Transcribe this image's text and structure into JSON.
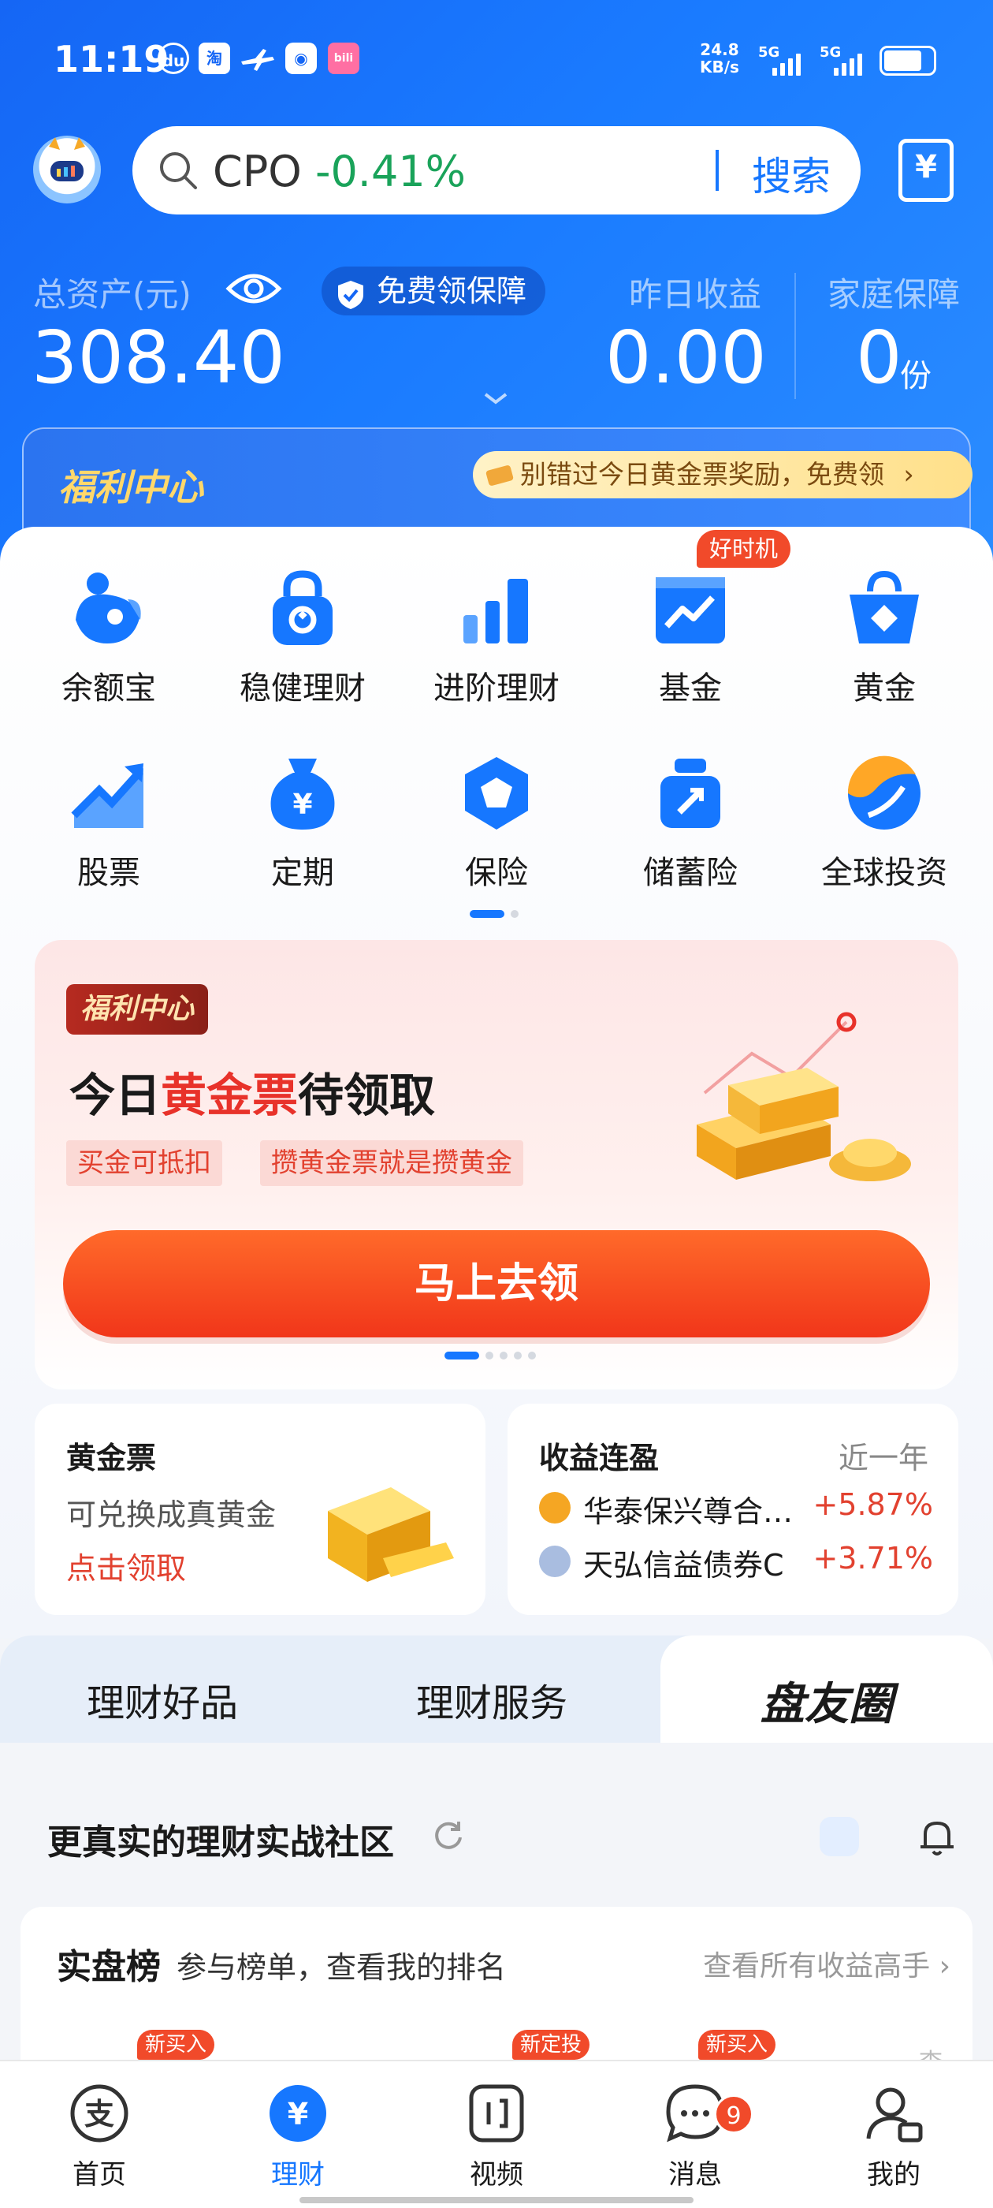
{
  "status_bar": {
    "time": "11:19",
    "net_speed_value": "24.8",
    "net_speed_unit": "KB/s",
    "sim1": "5G",
    "sim2": "5G",
    "icons": [
      "du-app-icon",
      "taobao-icon",
      "plane-icon",
      "camera-app-icon",
      "bilibili-icon"
    ]
  },
  "search": {
    "keyword": "CPO",
    "change": "-0.41%",
    "button": "搜索"
  },
  "assets": {
    "total_label": "总资产(元)",
    "total_value": "308.40",
    "guard_label": "免费领保障",
    "yesterday_label": "昨日收益",
    "yesterday_value": "0.00",
    "family_label": "家庭保障",
    "family_value": "0",
    "family_unit": "份"
  },
  "welfare_bar": {
    "title": "福利中心",
    "pill": "别错过今日黄金票奖励，免费领",
    "chevron": "›"
  },
  "grid": [
    {
      "label": "余额宝",
      "icon": "yuebao-icon"
    },
    {
      "label": "稳健理财",
      "icon": "wealth-lock-icon"
    },
    {
      "label": "进阶理财",
      "icon": "bar-growth-icon"
    },
    {
      "label": "基金",
      "icon": "fund-chart-icon"
    },
    {
      "label": "黄金",
      "icon": "gold-bag-icon"
    },
    {
      "label": "股票",
      "icon": "stock-trend-icon"
    },
    {
      "label": "定期",
      "icon": "money-bag-icon"
    },
    {
      "label": "保险",
      "icon": "insurance-hex-icon"
    },
    {
      "label": "储蓄险",
      "icon": "savings-jar-icon"
    },
    {
      "label": "全球投资",
      "icon": "globe-icon"
    }
  ],
  "grid_tag": "好时机",
  "banner": {
    "tag": "福利中心",
    "title_pre": "今日",
    "title_red": "黄金票",
    "title_post": "待领取",
    "chip1": "买金可抵扣",
    "chip2": "攒黄金票就是攒黄金",
    "button": "马上去领"
  },
  "gold_card": {
    "title": "黄金票",
    "sub": "可兑换成真黄金",
    "link": "点击领取"
  },
  "yield_card": {
    "title": "收益连盈",
    "period": "近一年",
    "funds": [
      {
        "name": "华泰保兴尊合…",
        "pct": "+5.87%"
      },
      {
        "name": "天弘信益债券C",
        "pct": "+3.71%"
      }
    ]
  },
  "tabs": [
    "理财好品",
    "理财服务",
    "盘友圈"
  ],
  "community": {
    "title": "更真实的理财实战社区",
    "rank_title": "实盘榜",
    "rank_sub": "参与榜单，查看我的排名",
    "rank_link": "查看所有收益高手",
    "rank_link_chevron": "›",
    "mini_tags": [
      "新买入",
      "新定投",
      "新买入"
    ],
    "trailing_char": "查"
  },
  "bottom_nav": [
    {
      "label": "首页",
      "icon": "alipay-home-icon"
    },
    {
      "label": "理财",
      "icon": "wealth-yen-icon"
    },
    {
      "label": "视频",
      "icon": "video-icon"
    },
    {
      "label": "消息",
      "icon": "message-icon"
    },
    {
      "label": "我的",
      "icon": "profile-icon"
    }
  ],
  "message_badge": "9",
  "colors": {
    "brand_blue": "#1677ff",
    "gain_red": "#e2412f",
    "loss_green": "#1aa35a"
  }
}
